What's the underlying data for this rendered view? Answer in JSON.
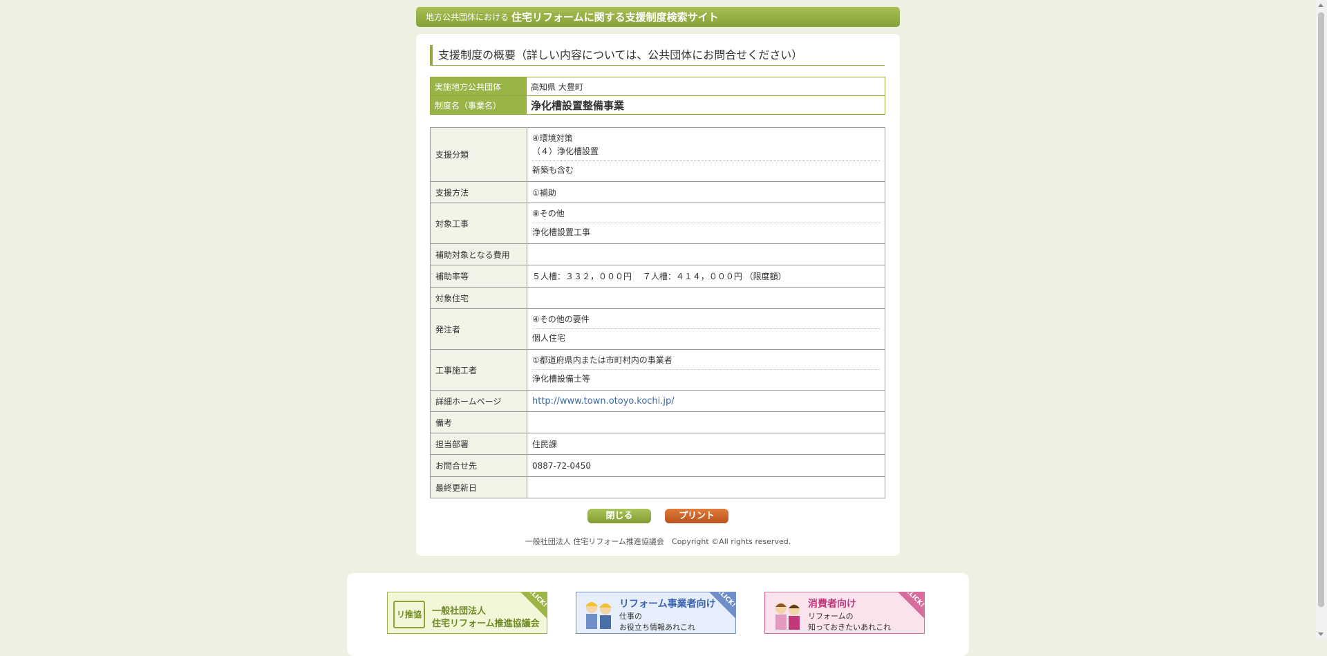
{
  "header": {
    "prefix": "地方公共団体における",
    "title": "住宅リフォームに関する支援制度検索サイト"
  },
  "section_title": "支援制度の概要（詳しい内容については、公共団体にお問合せください）",
  "summary": {
    "municipality_label": "実施地方公共団体",
    "municipality_value": "高知県 大豊町",
    "program_label": "制度名（事業名）",
    "program_value": "浄化槽設置整備事業"
  },
  "details": {
    "category": {
      "label": "支援分類",
      "line1": "④環境対策",
      "line2": "（４）浄化槽設置",
      "note": "新築も含む"
    },
    "method": {
      "label": "支援方法",
      "value": "①補助"
    },
    "target_work": {
      "label": "対象工事",
      "value": "⑧その他",
      "note": "浄化槽設置工事"
    },
    "eligible_cost": {
      "label": "補助対象となる費用",
      "value": ""
    },
    "rate": {
      "label": "補助率等",
      "value": "５人槽：３３２，０００円　 ７人槽：４１４，０００円 （限度額）"
    },
    "target_house": {
      "label": "対象住宅",
      "value": ""
    },
    "client": {
      "label": "発注者",
      "value": "④その他の要件",
      "note": "個人住宅"
    },
    "contractor": {
      "label": "工事施工者",
      "value": "①都道府県内または市町村内の事業者",
      "note": "浄化槽設備士等"
    },
    "homepage": {
      "label": "詳細ホームページ",
      "value": "http://www.town.otoyo.kochi.jp/"
    },
    "remarks": {
      "label": "備考",
      "value": ""
    },
    "department": {
      "label": "担当部署",
      "value": "住民課"
    },
    "contact": {
      "label": "お問合せ先",
      "value": "0887-72-0450"
    },
    "updated": {
      "label": "最終更新日",
      "value": ""
    }
  },
  "buttons": {
    "close": "閉じる",
    "print": "プリント"
  },
  "copyright": "一般社団法人 住宅リフォーム推進協議会　Copyright ©All rights reserved.",
  "banners": {
    "click": "CLICK!",
    "b1": {
      "logo": "リ推協",
      "line1": "一般社団法人",
      "line2": "住宅リフォーム推進協議会"
    },
    "b2": {
      "line1": "リフォーム事業者向け",
      "line2": "仕事の",
      "line3": "お役立ち情報あれこれ"
    },
    "b3": {
      "line1": "消費者向け",
      "line2": "リフォームの",
      "line3": "知っておきたいあれこれ"
    }
  },
  "colors": {
    "accent": "#8fab3c",
    "print_button": "#c85f26",
    "link": "#3a6aa6"
  }
}
